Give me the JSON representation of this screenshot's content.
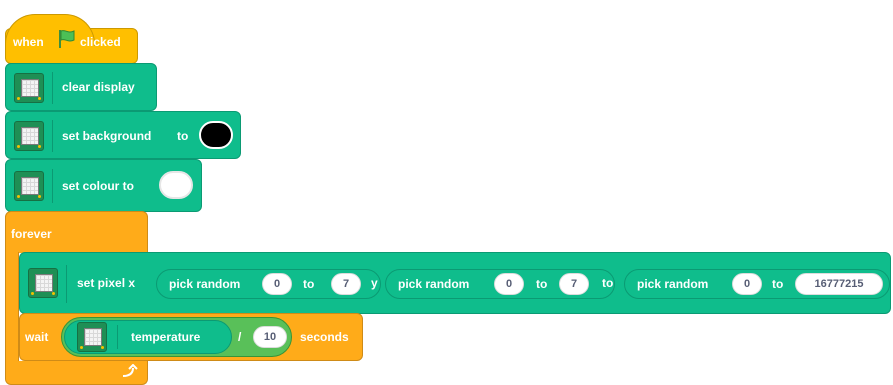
{
  "hat": {
    "when": "when",
    "clicked": "clicked",
    "flag_icon": "green-flag-icon",
    "flag_color": "#4cbf56"
  },
  "blocks": {
    "clear_display": "clear display",
    "set_background": {
      "label": "set background",
      "to": "to",
      "color": "#000000"
    },
    "set_colour": {
      "label": "set colour to",
      "color": "#ffffff"
    },
    "forever": "forever",
    "set_pixel": {
      "label": "set pixel x",
      "y_label": "y",
      "to_label": "to",
      "rand1": {
        "label": "pick random",
        "from": "0",
        "to_word": "to",
        "to": "7"
      },
      "rand2": {
        "label": "pick random",
        "from": "0",
        "to_word": "to",
        "to": "7"
      },
      "rand3": {
        "label": "pick random",
        "from": "0",
        "to_word": "to",
        "to": "16777215"
      }
    },
    "wait": {
      "label": "wait",
      "reporter": "temperature",
      "op": "/",
      "divisor": "10",
      "suffix": "seconds"
    },
    "loop_icon": "loop-arrow-icon"
  },
  "colors": {
    "event": "#ffbf00",
    "control": "#ffab19",
    "extension": "#0fbd8c"
  }
}
